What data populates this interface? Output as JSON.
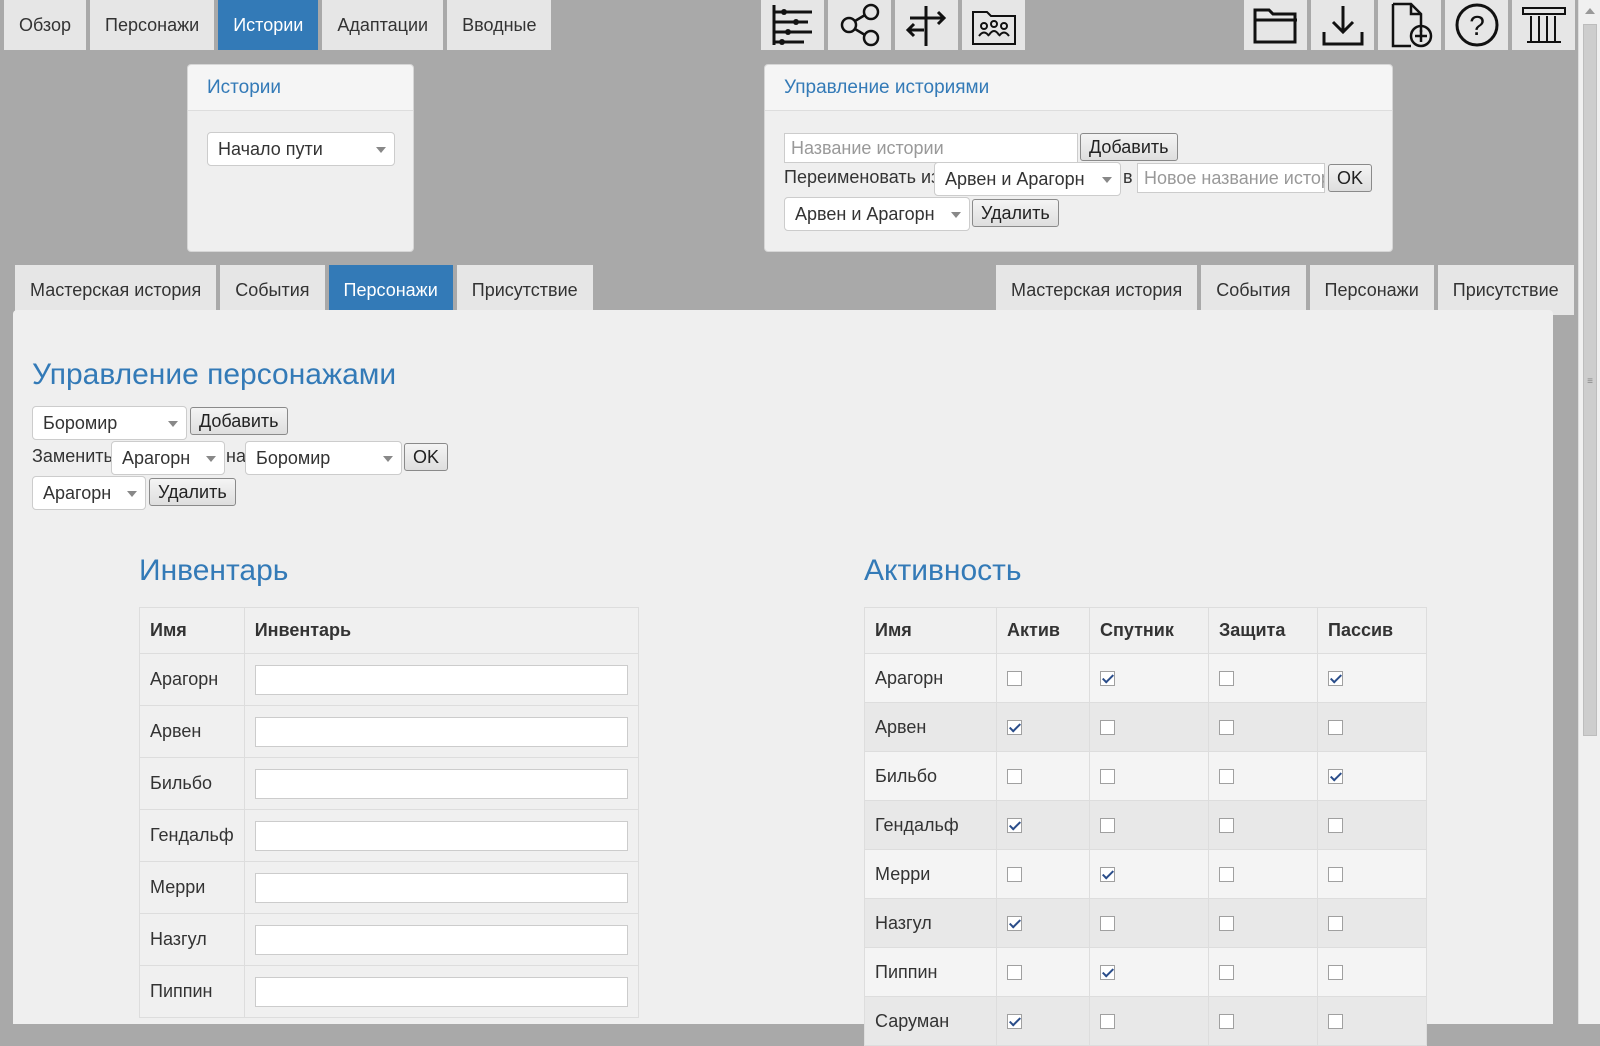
{
  "nav": {
    "tabs": [
      {
        "label": "Обзор"
      },
      {
        "label": "Персонажи"
      },
      {
        "label": "Истории"
      },
      {
        "label": "Адаптации"
      },
      {
        "label": "Вводные"
      }
    ],
    "active_index": 2
  },
  "toolbar": {
    "icons": [
      "timeline-icon",
      "share-icon",
      "split-arrows-icon",
      "group-folder-icon",
      "open-folder-icon",
      "download-icon",
      "new-file-icon",
      "help-icon",
      "logo-column-icon"
    ]
  },
  "stories_panel": {
    "title": "Истории",
    "selected_story": "Начало пути"
  },
  "manage_panel": {
    "title": "Управление историями",
    "name_placeholder": "Название истории",
    "add_label": "Добавить",
    "rename_label": "Переименовать из",
    "rename_from": "Арвен и Арагорн",
    "to_label": "в",
    "new_name_placeholder": "Новое название истори",
    "ok_label": "OK",
    "delete_select": "Арвен и Арагорн",
    "delete_label": "Удалить"
  },
  "subtabs_left": {
    "tabs": [
      {
        "label": "Мастерская история"
      },
      {
        "label": "События"
      },
      {
        "label": "Персонажи"
      },
      {
        "label": "Присутствие"
      }
    ],
    "active_index": 2
  },
  "subtabs_right": {
    "tabs": [
      {
        "label": "Мастерская история"
      },
      {
        "label": "События"
      },
      {
        "label": "Персонажи"
      },
      {
        "label": "Присутствие"
      }
    ]
  },
  "characters": {
    "title": "Управление персонажами",
    "add_select": "Боромир",
    "add_label": "Добавить",
    "replace_label": "Заменить",
    "replace_from": "Арагорн",
    "on_label": "на",
    "replace_to": "Боромир",
    "ok_label": "OK",
    "delete_select": "Арагорн",
    "delete_label": "Удалить"
  },
  "inventory": {
    "title": "Инвентарь",
    "headers": [
      "Имя",
      "Инвентарь"
    ],
    "rows": [
      {
        "name": "Арагорн",
        "value": ""
      },
      {
        "name": "Арвен",
        "value": ""
      },
      {
        "name": "Бильбо",
        "value": ""
      },
      {
        "name": "Гендальф",
        "value": ""
      },
      {
        "name": "Мерри",
        "value": ""
      },
      {
        "name": "Назгул",
        "value": ""
      },
      {
        "name": "Пиппин",
        "value": ""
      }
    ]
  },
  "activity": {
    "title": "Активность",
    "headers": [
      "Имя",
      "Актив",
      "Спутник",
      "Защита",
      "Пассив"
    ],
    "rows": [
      {
        "name": "Арагорн",
        "checks": [
          false,
          true,
          false,
          true
        ]
      },
      {
        "name": "Арвен",
        "checks": [
          true,
          false,
          false,
          false
        ]
      },
      {
        "name": "Бильбо",
        "checks": [
          false,
          false,
          false,
          true
        ]
      },
      {
        "name": "Гендальф",
        "checks": [
          true,
          false,
          false,
          false
        ]
      },
      {
        "name": "Мерри",
        "checks": [
          false,
          true,
          false,
          false
        ]
      },
      {
        "name": "Назгул",
        "checks": [
          true,
          false,
          false,
          false
        ]
      },
      {
        "name": "Пиппин",
        "checks": [
          false,
          true,
          false,
          false
        ]
      },
      {
        "name": "Саруман",
        "checks": [
          true,
          false,
          false,
          false
        ]
      }
    ]
  }
}
